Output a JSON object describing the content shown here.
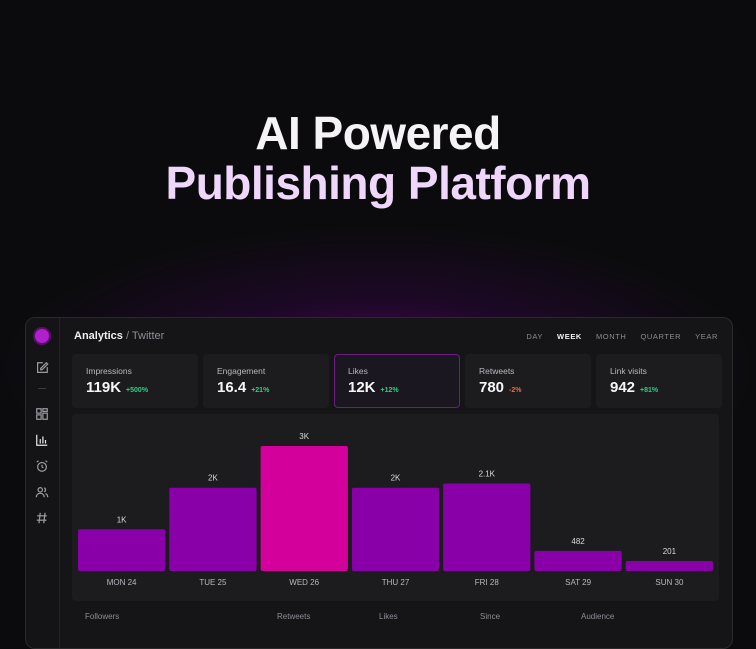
{
  "hero": {
    "line1": "AI Powered",
    "line2": "Publishing Platform"
  },
  "colors": {
    "accent": "#8a00a8",
    "highlight": "#d4009c",
    "positive": "#2fd07f",
    "negative": "#f06a3a"
  },
  "sidebar": {
    "icons": [
      "edit-icon",
      "dashboard-icon",
      "bar-chart-icon",
      "alarm-icon",
      "users-icon",
      "hashtag-icon"
    ]
  },
  "header": {
    "title": "Analytics",
    "separator": "/",
    "subtitle": "Twitter",
    "ranges": [
      "DAY",
      "WEEK",
      "MONTH",
      "QUARTER",
      "YEAR"
    ],
    "active_range": "WEEK"
  },
  "metrics": [
    {
      "label": "Impressions",
      "value": "119K",
      "delta": "+500%",
      "trend": "up"
    },
    {
      "label": "Engagement",
      "value": "16.4",
      "delta": "+21%",
      "trend": "up"
    },
    {
      "label": "Likes",
      "value": "12K",
      "delta": "+12%",
      "trend": "up",
      "selected": true
    },
    {
      "label": "Retweets",
      "value": "780",
      "delta": "-2%",
      "trend": "down"
    },
    {
      "label": "Link visits",
      "value": "942",
      "delta": "+81%",
      "trend": "up"
    }
  ],
  "chart_data": {
    "type": "bar",
    "categories": [
      "MON 24",
      "TUE 25",
      "WED 26",
      "THU 27",
      "FRI 28",
      "SAT 29",
      "SUN 30"
    ],
    "values": [
      1000,
      2000,
      3000,
      2000,
      2100,
      482,
      201
    ],
    "data_labels": [
      "1K",
      "2K",
      "3K",
      "2K",
      "2.1K",
      "482",
      "201"
    ],
    "highlight_index": 2,
    "ylim": [
      0,
      3000
    ],
    "grid": false
  },
  "table": {
    "columns": [
      "Followers",
      "Retweets",
      "Likes",
      "Since",
      "Audience"
    ]
  }
}
